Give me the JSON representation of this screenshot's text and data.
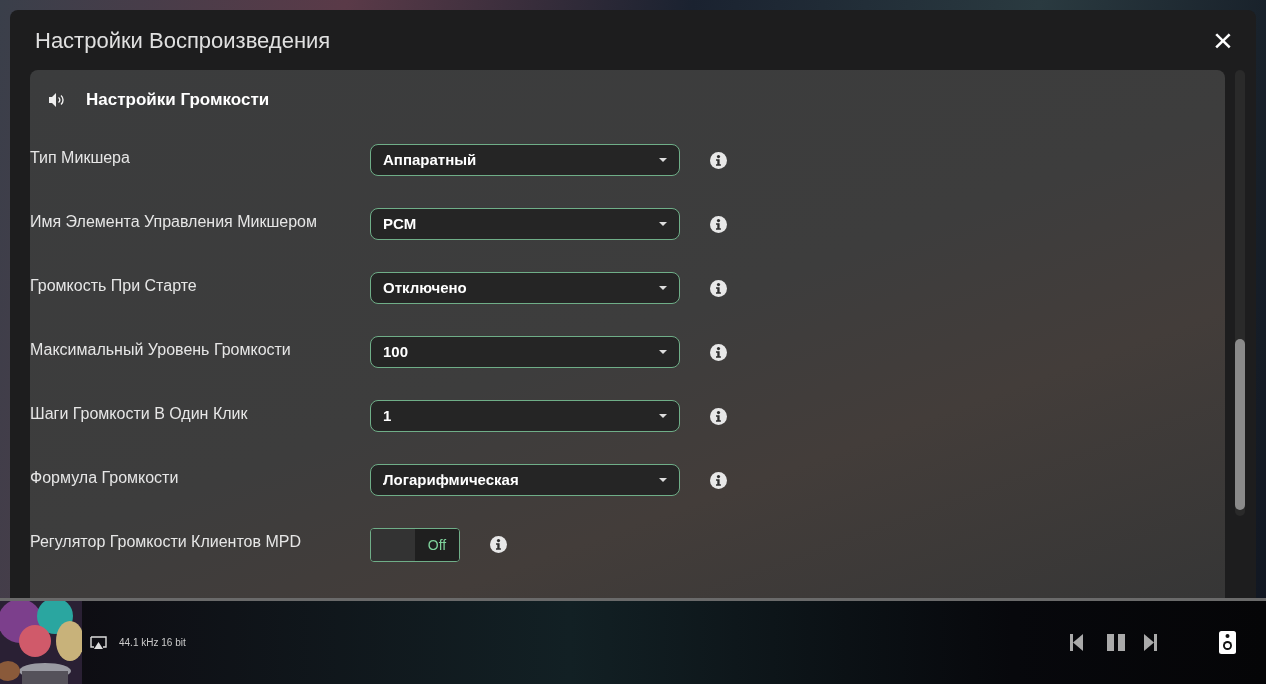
{
  "dialog": {
    "title": "Настройки Воспроизведения",
    "close": "×"
  },
  "section": {
    "title": "Настройки Громкости"
  },
  "settings": [
    {
      "kind": "select",
      "label": "Тип Микшера",
      "value": "Аппаратный"
    },
    {
      "kind": "select",
      "label": "Имя Элемента Управления Микшером",
      "value": "PCM"
    },
    {
      "kind": "select",
      "label": "Громкость При Старте",
      "value": "Отключено"
    },
    {
      "kind": "select",
      "label": "Максимальный Уровень Громкости",
      "value": "100"
    },
    {
      "kind": "select",
      "label": "Шаги Громкости В Один Клик",
      "value": "1"
    },
    {
      "kind": "select",
      "label": "Формула Громкости",
      "value": "Логарифмическая"
    },
    {
      "kind": "switch",
      "label": "Регулятор Громкости Клиентов MPD",
      "on": false,
      "state_label": "Off"
    }
  ],
  "player": {
    "format": "44.1 kHz 16 bit"
  }
}
